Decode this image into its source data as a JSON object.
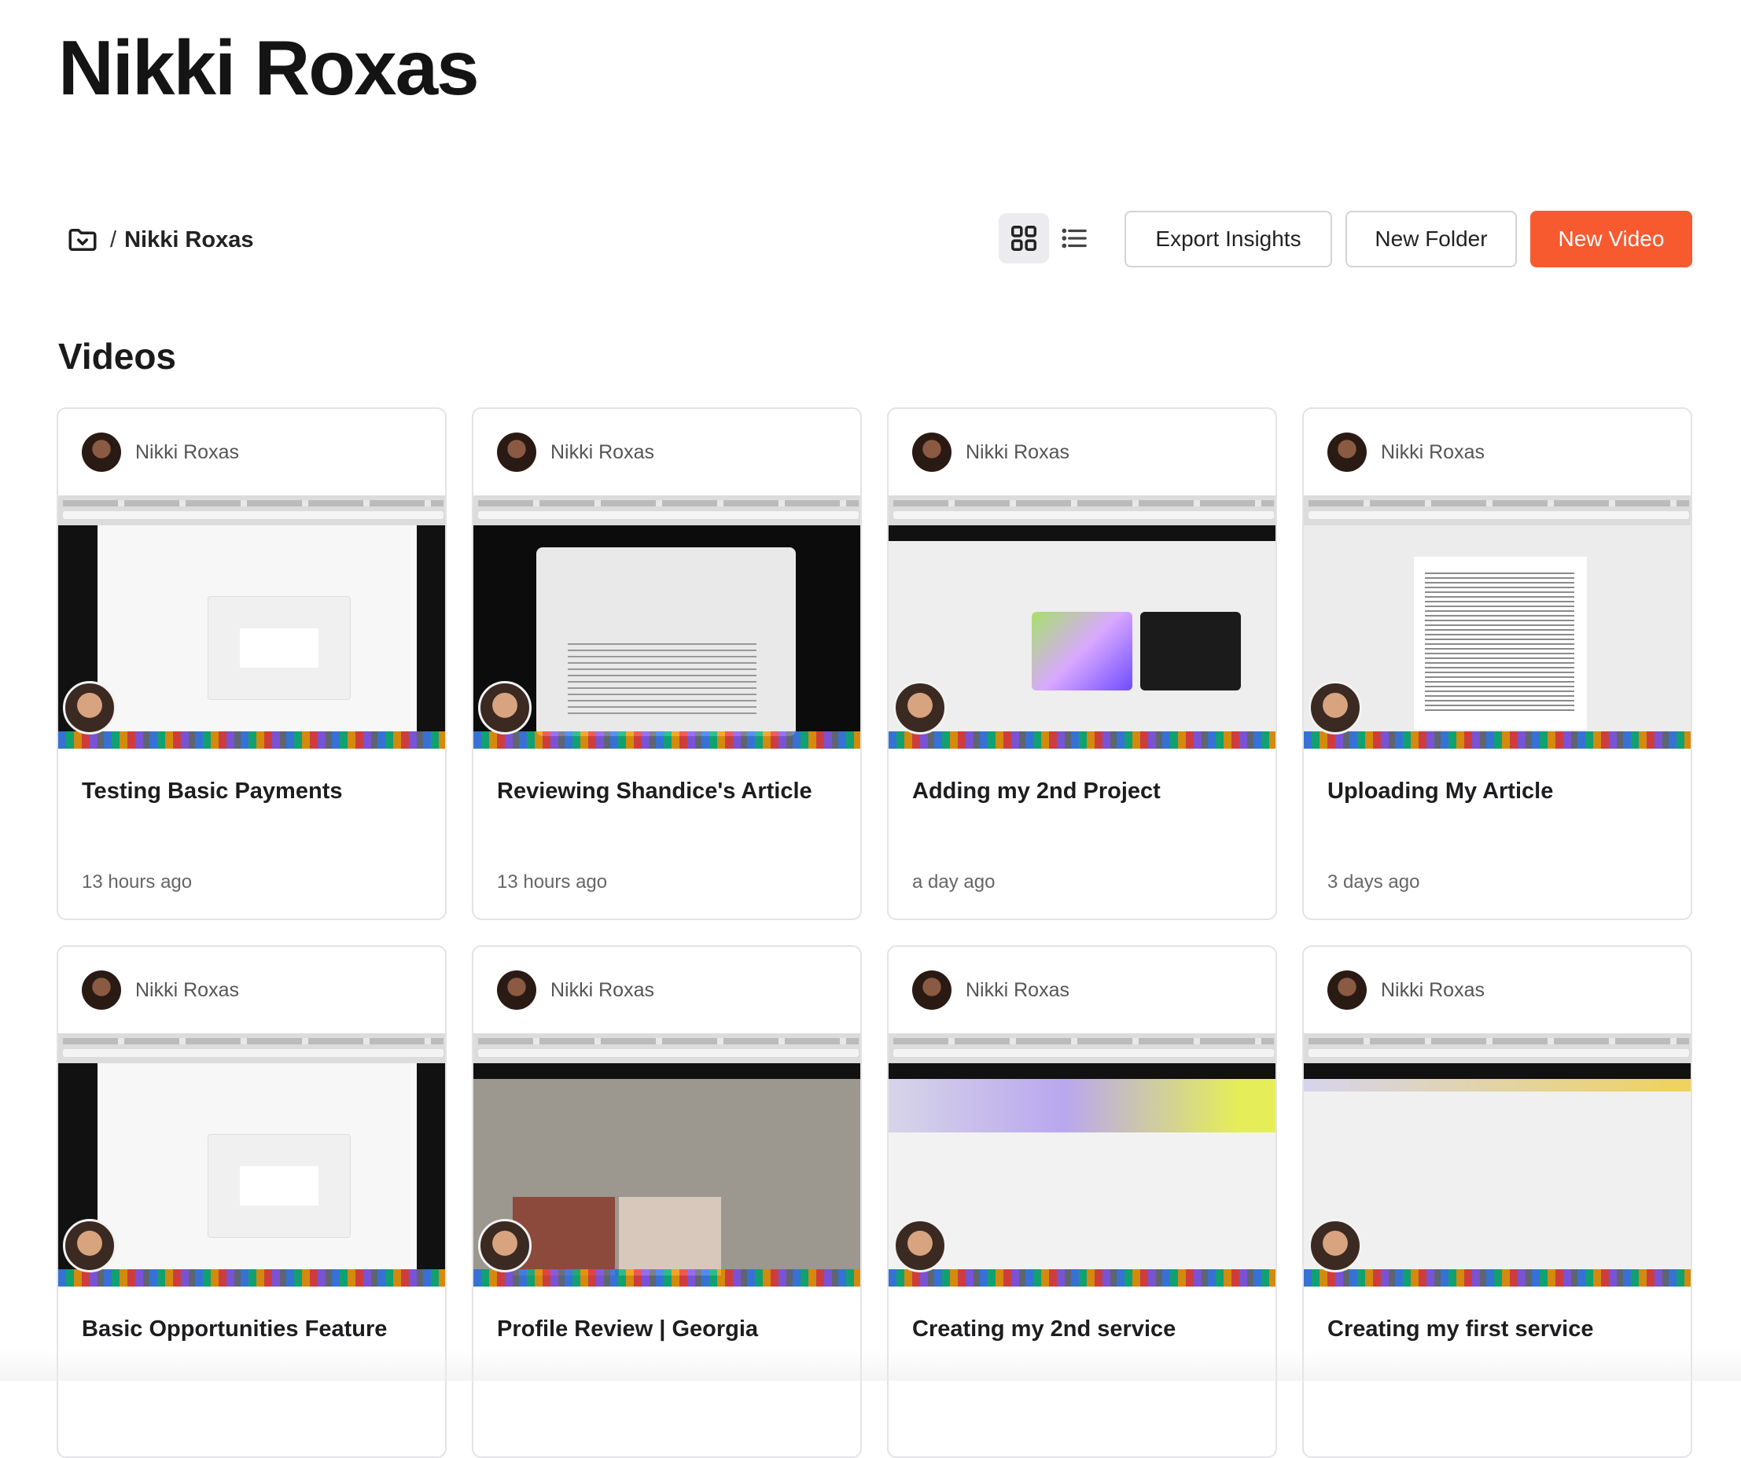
{
  "page": {
    "title": "Nikki Roxas"
  },
  "breadcrumb": {
    "separator": "/",
    "current": "Nikki Roxas"
  },
  "toolbar": {
    "grid_view_active": true,
    "export_label": "Export Insights",
    "new_folder_label": "New Folder",
    "new_video_label": "New Video",
    "accent_color": "#f85a30"
  },
  "videos_section": {
    "title": "Videos"
  },
  "videos": [
    {
      "author": "Nikki Roxas",
      "title": "Testing Basic Payments",
      "time": "13 hours ago",
      "thumb": "gmail"
    },
    {
      "author": "Nikki Roxas",
      "title": "Reviewing Shandice's Article",
      "time": "13 hours ago",
      "thumb": "article"
    },
    {
      "author": "Nikki Roxas",
      "title": "Adding my 2nd Project",
      "time": "a day ago",
      "thumb": "project"
    },
    {
      "author": "Nikki Roxas",
      "title": "Uploading My Article",
      "time": "3 days ago",
      "thumb": "doc"
    },
    {
      "author": "Nikki Roxas",
      "title": "Basic Opportunities Feature",
      "time": "",
      "thumb": "gmail"
    },
    {
      "author": "Nikki Roxas",
      "title": "Profile Review | Georgia",
      "time": "",
      "thumb": "profile"
    },
    {
      "author": "Nikki Roxas",
      "title": "Creating my 2nd service",
      "time": "",
      "thumb": "service"
    },
    {
      "author": "Nikki Roxas",
      "title": "Creating my first service",
      "time": "",
      "thumb": "first"
    }
  ]
}
